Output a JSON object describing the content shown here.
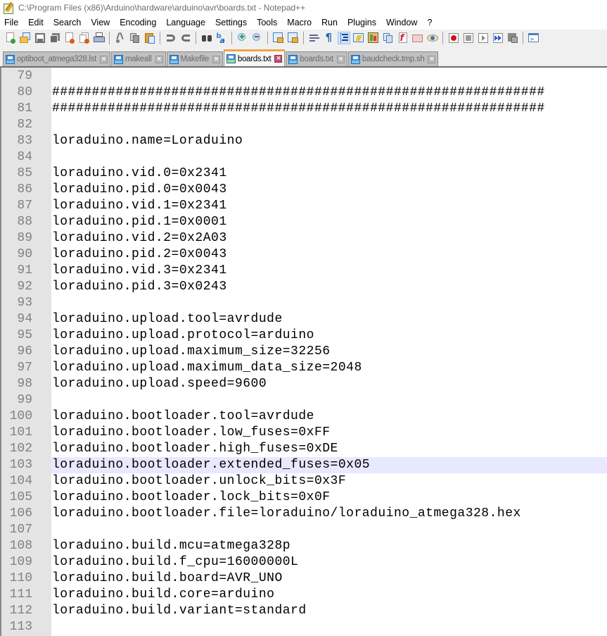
{
  "window": {
    "title": "C:\\Program Files (x86)\\Arduino\\hardware\\arduino\\avr\\boards.txt - Notepad++",
    "app_icon": "notepad-plus-plus-icon"
  },
  "menu": [
    "File",
    "Edit",
    "Search",
    "View",
    "Encoding",
    "Language",
    "Settings",
    "Tools",
    "Macro",
    "Run",
    "Plugins",
    "Window",
    "?"
  ],
  "toolbar": [
    {
      "name": "new-file-icon"
    },
    {
      "name": "open-file-icon"
    },
    {
      "name": "save-icon"
    },
    {
      "name": "save-all-icon"
    },
    {
      "name": "close-icon"
    },
    {
      "name": "close-all-icon"
    },
    {
      "name": "print-icon"
    },
    {
      "sep": true
    },
    {
      "name": "cut-icon"
    },
    {
      "name": "copy-icon"
    },
    {
      "name": "paste-icon"
    },
    {
      "sep": true
    },
    {
      "name": "undo-icon"
    },
    {
      "name": "redo-icon"
    },
    {
      "sep": true
    },
    {
      "name": "find-icon"
    },
    {
      "name": "replace-icon"
    },
    {
      "sep": true
    },
    {
      "name": "zoom-in-icon"
    },
    {
      "name": "zoom-out-icon"
    },
    {
      "sep": true
    },
    {
      "name": "sync-vertical-icon"
    },
    {
      "name": "sync-horizontal-icon"
    },
    {
      "sep": true
    },
    {
      "name": "word-wrap-icon"
    },
    {
      "name": "show-all-characters-icon"
    },
    {
      "name": "indent-guide-icon",
      "active": true
    },
    {
      "name": "user-defined-language-icon"
    },
    {
      "name": "document-map-icon"
    },
    {
      "name": "document-list-icon"
    },
    {
      "name": "function-list-icon"
    },
    {
      "name": "folder-as-workspace-icon"
    },
    {
      "name": "monitoring-icon"
    },
    {
      "sep": true
    },
    {
      "name": "record-macro-icon"
    },
    {
      "name": "stop-recording-icon"
    },
    {
      "name": "play-macro-icon"
    },
    {
      "name": "run-macro-multiple-icon"
    },
    {
      "name": "save-macro-icon"
    },
    {
      "sep": true
    },
    {
      "name": "console-icon"
    }
  ],
  "tabs": [
    {
      "label": "optiboot_atmega328.lst",
      "active": false
    },
    {
      "label": "makeall",
      "active": false
    },
    {
      "label": "Makefile",
      "active": false
    },
    {
      "label": "boards.txt",
      "active": true
    },
    {
      "label": "boards.txt",
      "active": false
    },
    {
      "label": "baudcheck.tmp.sh",
      "active": false
    }
  ],
  "editor": {
    "current_line": 103,
    "lines": [
      {
        "n": "79",
        "text": ""
      },
      {
        "n": "80",
        "text": "##############################################################"
      },
      {
        "n": "81",
        "text": "##############################################################"
      },
      {
        "n": "82",
        "text": ""
      },
      {
        "n": "83",
        "text": "loraduino.name=Loraduino"
      },
      {
        "n": "84",
        "text": ""
      },
      {
        "n": "85",
        "text": "loraduino.vid.0=0x2341"
      },
      {
        "n": "86",
        "text": "loraduino.pid.0=0x0043"
      },
      {
        "n": "87",
        "text": "loraduino.vid.1=0x2341"
      },
      {
        "n": "88",
        "text": "loraduino.pid.1=0x0001"
      },
      {
        "n": "89",
        "text": "loraduino.vid.2=0x2A03"
      },
      {
        "n": "90",
        "text": "loraduino.pid.2=0x0043"
      },
      {
        "n": "91",
        "text": "loraduino.vid.3=0x2341"
      },
      {
        "n": "92",
        "text": "loraduino.pid.3=0x0243"
      },
      {
        "n": "93",
        "text": ""
      },
      {
        "n": "94",
        "text": "loraduino.upload.tool=avrdude"
      },
      {
        "n": "95",
        "text": "loraduino.upload.protocol=arduino"
      },
      {
        "n": "96",
        "text": "loraduino.upload.maximum_size=32256"
      },
      {
        "n": "97",
        "text": "loraduino.upload.maximum_data_size=2048"
      },
      {
        "n": "98",
        "text": "loraduino.upload.speed=9600"
      },
      {
        "n": "99",
        "text": ""
      },
      {
        "n": "100",
        "text": "loraduino.bootloader.tool=avrdude"
      },
      {
        "n": "101",
        "text": "loraduino.bootloader.low_fuses=0xFF"
      },
      {
        "n": "102",
        "text": "loraduino.bootloader.high_fuses=0xDE"
      },
      {
        "n": "103",
        "text": "loraduino.bootloader.extended_fuses=0x05"
      },
      {
        "n": "104",
        "text": "loraduino.bootloader.unlock_bits=0x3F"
      },
      {
        "n": "105",
        "text": "loraduino.bootloader.lock_bits=0x0F"
      },
      {
        "n": "106",
        "text": "loraduino.bootloader.file=loraduino/loraduino_atmega328.hex"
      },
      {
        "n": "107",
        "text": ""
      },
      {
        "n": "108",
        "text": "loraduino.build.mcu=atmega328p"
      },
      {
        "n": "109",
        "text": "loraduino.build.f_cpu=16000000L"
      },
      {
        "n": "110",
        "text": "loraduino.build.board=AVR_UNO"
      },
      {
        "n": "111",
        "text": "loraduino.build.core=arduino"
      },
      {
        "n": "112",
        "text": "loraduino.build.variant=standard"
      },
      {
        "n": "113",
        "text": ""
      }
    ]
  },
  "colors": {
    "active_tab_accent": "#f4a545",
    "current_line_bg": "#e8e8ff",
    "gutter_bg": "#e4e4e4",
    "line_number": "#808080"
  }
}
